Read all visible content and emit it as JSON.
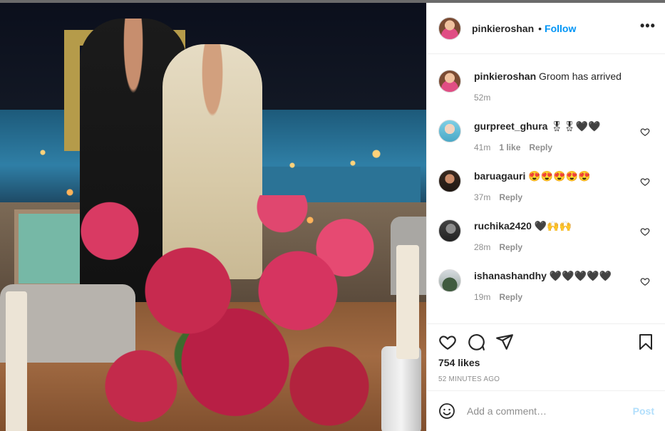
{
  "post": {
    "username": "pinkieroshan",
    "follow_label": "Follow",
    "separator": "•",
    "more_label": "•••"
  },
  "caption": {
    "username": "pinkieroshan",
    "text": "Groom has arrived",
    "time": "52m"
  },
  "comments": [
    {
      "username": "gurpreet_ghura",
      "text": "🎖🎖🖤🖤",
      "time": "41m",
      "likes": "1 like",
      "reply": "Reply"
    },
    {
      "username": "baruagauri",
      "text": "😍😍😍😍😍",
      "time": "37m",
      "likes": "",
      "reply": "Reply"
    },
    {
      "username": "ruchika2420",
      "text": "🖤🙌🙌",
      "time": "28m",
      "likes": "",
      "reply": "Reply"
    },
    {
      "username": "ishanashandhy",
      "text": "🖤🖤🖤🖤🖤",
      "time": "19m",
      "likes": "",
      "reply": "Reply"
    }
  ],
  "footer": {
    "likes": "754 likes",
    "timestamp": "52 MINUTES AGO",
    "comment_placeholder": "Add a comment…",
    "post_label": "Post"
  },
  "icons": {
    "more": "more-icon",
    "like": "heart-icon",
    "comment": "comment-icon",
    "share": "share-icon",
    "save": "bookmark-icon",
    "emoji": "emoji-icon"
  },
  "colors": {
    "accent": "#0095f6",
    "post_disabled": "#b2dffc",
    "muted": "#8e8e8e"
  }
}
